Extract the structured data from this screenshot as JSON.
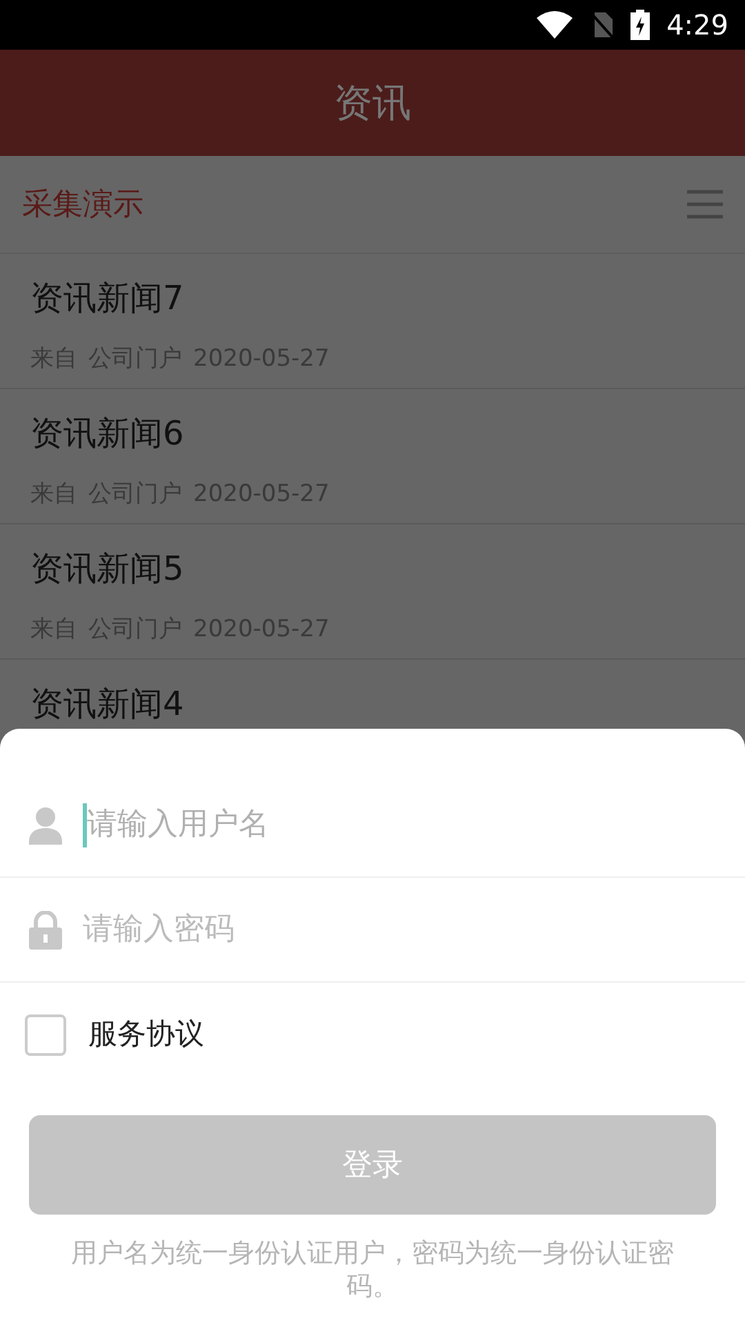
{
  "status_bar": {
    "time": "4:29"
  },
  "header": {
    "title": "资讯"
  },
  "section": {
    "title": "采集演示"
  },
  "news": [
    {
      "title": "资讯新闻7",
      "source": "来自",
      "publisher": "公司门户",
      "date": "2020-05-27"
    },
    {
      "title": "资讯新闻6",
      "source": "来自",
      "publisher": "公司门户",
      "date": "2020-05-27"
    },
    {
      "title": "资讯新闻5",
      "source": "来自",
      "publisher": "公司门户",
      "date": "2020-05-27"
    },
    {
      "title": "资讯新闻4"
    }
  ],
  "login": {
    "fields": [
      {
        "kind": "user",
        "placeholder": "请输入用户名",
        "focused": true
      },
      {
        "kind": "password",
        "placeholder": "请输入密码",
        "focused": false
      }
    ],
    "agreement": {
      "label": "服务协议",
      "checked": false
    },
    "button": {
      "label": "登录",
      "disabled": true
    },
    "note": "用户名为统一身份认证用户，密码为统一身份认证密码。"
  }
}
